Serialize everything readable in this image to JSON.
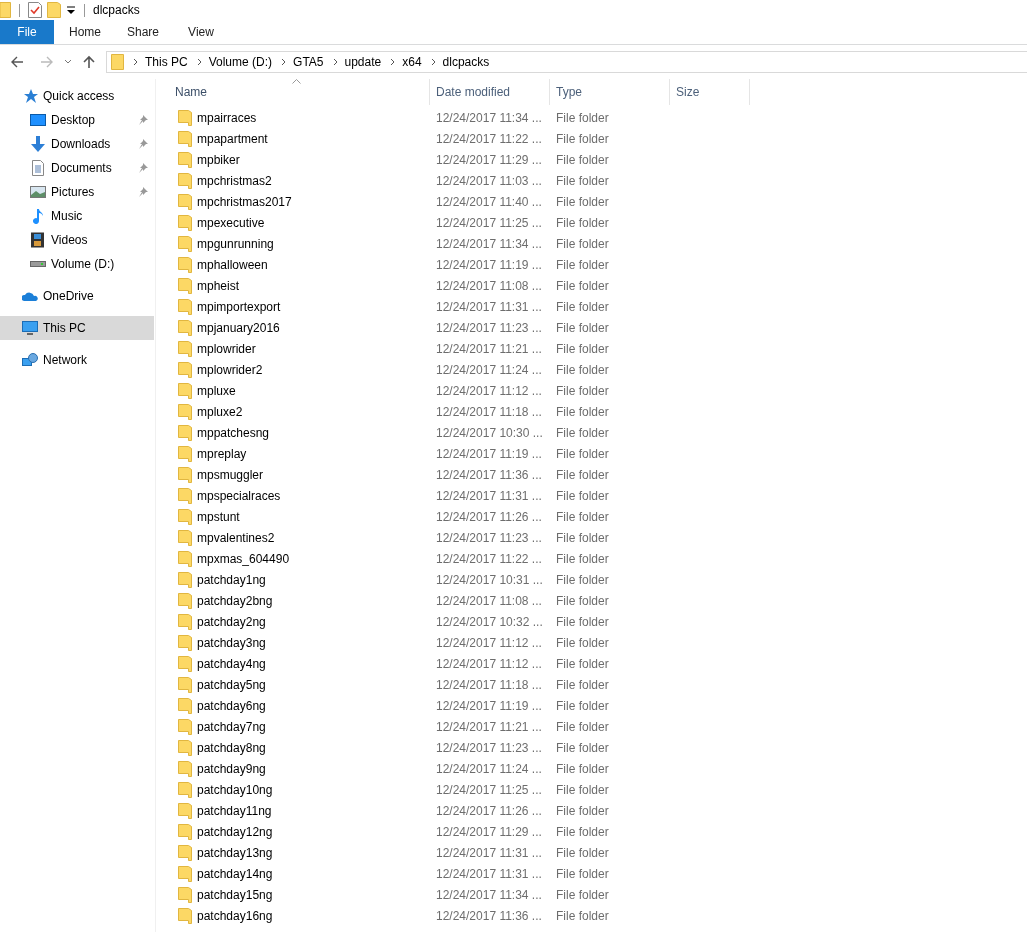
{
  "window": {
    "title": "dlcpacks"
  },
  "ribbon_tabs": [
    {
      "label": "File",
      "kind": "file"
    },
    {
      "label": "Home",
      "kind": "tab"
    },
    {
      "label": "Share",
      "kind": "tab"
    },
    {
      "label": "View",
      "kind": "tab"
    }
  ],
  "navigation": {
    "forward_disabled": true,
    "breadcrumb": [
      "This PC",
      "Volume (D:)",
      "GTA5",
      "update",
      "x64",
      "dlcpacks"
    ]
  },
  "sidebar": {
    "items": [
      {
        "label": "Quick access",
        "kind": "star",
        "selected": false,
        "children": [
          {
            "label": "Desktop",
            "kind": "desktop",
            "pinned": true,
            "selected": false
          },
          {
            "label": "Downloads",
            "kind": "download",
            "pinned": true,
            "selected": false
          },
          {
            "label": "Documents",
            "kind": "document",
            "pinned": true,
            "selected": false
          },
          {
            "label": "Pictures",
            "kind": "pictures",
            "pinned": true,
            "selected": false
          },
          {
            "label": "Music",
            "kind": "music",
            "pinned": false,
            "selected": false
          },
          {
            "label": "Videos",
            "kind": "videos",
            "pinned": false,
            "selected": false
          },
          {
            "label": "Volume (D:)",
            "kind": "drive",
            "pinned": false,
            "selected": false
          }
        ]
      },
      {
        "label": "OneDrive",
        "kind": "cloud",
        "selected": false
      },
      {
        "label": "This PC",
        "kind": "pc",
        "selected": true
      },
      {
        "label": "Network",
        "kind": "network",
        "selected": false
      }
    ]
  },
  "table": {
    "columns": [
      {
        "label": "Name",
        "sorted": true
      },
      {
        "label": "Date modified",
        "sorted": false
      },
      {
        "label": "Type",
        "sorted": false
      },
      {
        "label": "Size",
        "sorted": false
      }
    ],
    "rows": [
      {
        "name": "mpairraces",
        "date": "12/24/2017 11:34 ...",
        "type": "File folder"
      },
      {
        "name": "mpapartment",
        "date": "12/24/2017 11:22 ...",
        "type": "File folder"
      },
      {
        "name": "mpbiker",
        "date": "12/24/2017 11:29 ...",
        "type": "File folder"
      },
      {
        "name": "mpchristmas2",
        "date": "12/24/2017 11:03 ...",
        "type": "File folder"
      },
      {
        "name": "mpchristmas2017",
        "date": "12/24/2017 11:40 ...",
        "type": "File folder"
      },
      {
        "name": "mpexecutive",
        "date": "12/24/2017 11:25 ...",
        "type": "File folder"
      },
      {
        "name": "mpgunrunning",
        "date": "12/24/2017 11:34 ...",
        "type": "File folder"
      },
      {
        "name": "mphalloween",
        "date": "12/24/2017 11:19 ...",
        "type": "File folder"
      },
      {
        "name": "mpheist",
        "date": "12/24/2017 11:08 ...",
        "type": "File folder"
      },
      {
        "name": "mpimportexport",
        "date": "12/24/2017 11:31 ...",
        "type": "File folder"
      },
      {
        "name": "mpjanuary2016",
        "date": "12/24/2017 11:23 ...",
        "type": "File folder"
      },
      {
        "name": "mplowrider",
        "date": "12/24/2017 11:21 ...",
        "type": "File folder"
      },
      {
        "name": "mplowrider2",
        "date": "12/24/2017 11:24 ...",
        "type": "File folder"
      },
      {
        "name": "mpluxe",
        "date": "12/24/2017 11:12 ...",
        "type": "File folder"
      },
      {
        "name": "mpluxe2",
        "date": "12/24/2017 11:18 ...",
        "type": "File folder"
      },
      {
        "name": "mppatchesng",
        "date": "12/24/2017 10:30 ...",
        "type": "File folder"
      },
      {
        "name": "mpreplay",
        "date": "12/24/2017 11:19 ...",
        "type": "File folder"
      },
      {
        "name": "mpsmuggler",
        "date": "12/24/2017 11:36 ...",
        "type": "File folder"
      },
      {
        "name": "mpspecialraces",
        "date": "12/24/2017 11:31 ...",
        "type": "File folder"
      },
      {
        "name": "mpstunt",
        "date": "12/24/2017 11:26 ...",
        "type": "File folder"
      },
      {
        "name": "mpvalentines2",
        "date": "12/24/2017 11:23 ...",
        "type": "File folder"
      },
      {
        "name": "mpxmas_604490",
        "date": "12/24/2017 11:22 ...",
        "type": "File folder"
      },
      {
        "name": "patchday1ng",
        "date": "12/24/2017 10:31 ...",
        "type": "File folder"
      },
      {
        "name": "patchday2bng",
        "date": "12/24/2017 11:08 ...",
        "type": "File folder"
      },
      {
        "name": "patchday2ng",
        "date": "12/24/2017 10:32 ...",
        "type": "File folder"
      },
      {
        "name": "patchday3ng",
        "date": "12/24/2017 11:12 ...",
        "type": "File folder"
      },
      {
        "name": "patchday4ng",
        "date": "12/24/2017 11:12 ...",
        "type": "File folder"
      },
      {
        "name": "patchday5ng",
        "date": "12/24/2017 11:18 ...",
        "type": "File folder"
      },
      {
        "name": "patchday6ng",
        "date": "12/24/2017 11:19 ...",
        "type": "File folder"
      },
      {
        "name": "patchday7ng",
        "date": "12/24/2017 11:21 ...",
        "type": "File folder"
      },
      {
        "name": "patchday8ng",
        "date": "12/24/2017 11:23 ...",
        "type": "File folder"
      },
      {
        "name": "patchday9ng",
        "date": "12/24/2017 11:24 ...",
        "type": "File folder"
      },
      {
        "name": "patchday10ng",
        "date": "12/24/2017 11:25 ...",
        "type": "File folder"
      },
      {
        "name": "patchday11ng",
        "date": "12/24/2017 11:26 ...",
        "type": "File folder"
      },
      {
        "name": "patchday12ng",
        "date": "12/24/2017 11:29 ...",
        "type": "File folder"
      },
      {
        "name": "patchday13ng",
        "date": "12/24/2017 11:31 ...",
        "type": "File folder"
      },
      {
        "name": "patchday14ng",
        "date": "12/24/2017 11:31 ...",
        "type": "File folder"
      },
      {
        "name": "patchday15ng",
        "date": "12/24/2017 11:34 ...",
        "type": "File folder"
      },
      {
        "name": "patchday16ng",
        "date": "12/24/2017 11:36 ...",
        "type": "File folder"
      }
    ]
  }
}
